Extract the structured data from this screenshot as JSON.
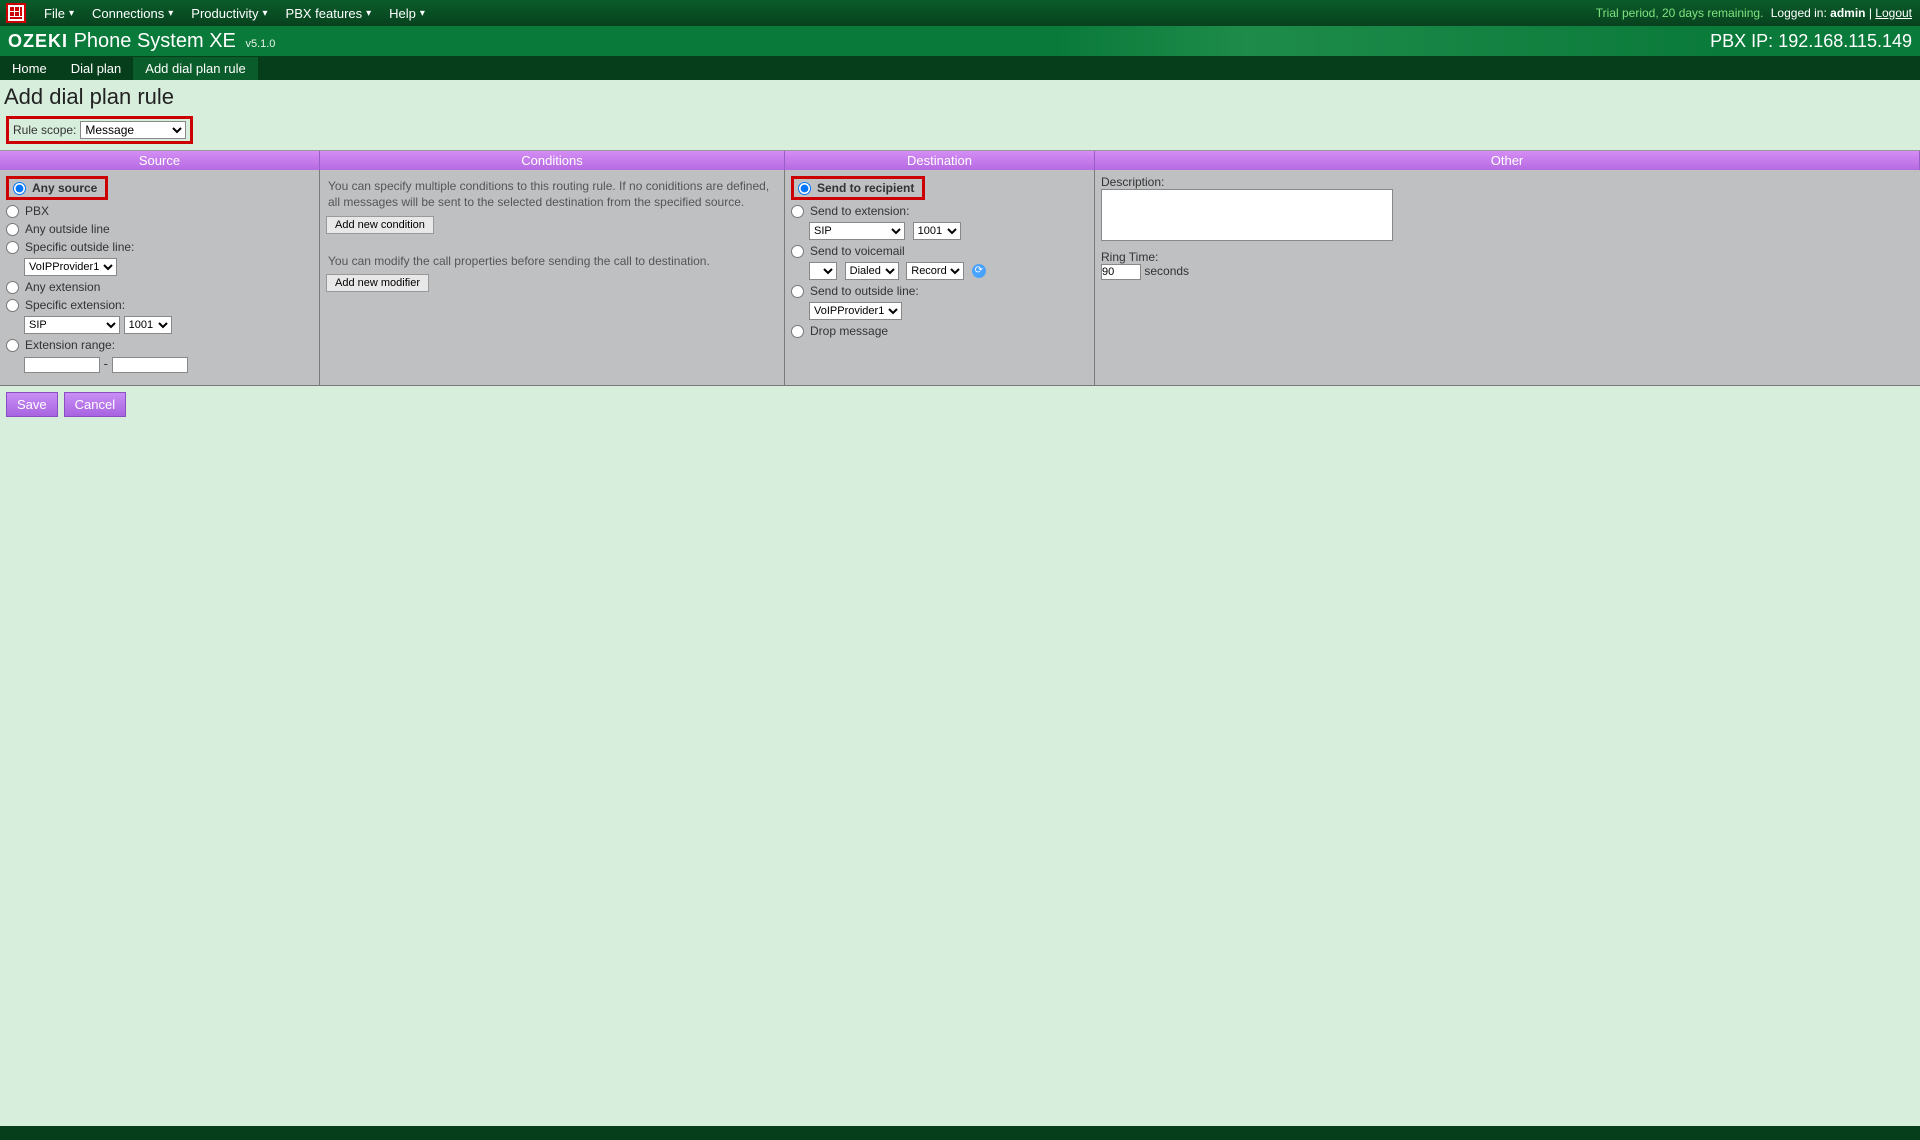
{
  "topnav": {
    "menus": [
      {
        "label": "File"
      },
      {
        "label": "Connections"
      },
      {
        "label": "Productivity"
      },
      {
        "label": "PBX features"
      },
      {
        "label": "Help"
      }
    ],
    "trial_text": "Trial period, 20 days remaining.",
    "logged_in_prefix": "Logged in:",
    "user": "admin",
    "sep": " | ",
    "logout": "Logout"
  },
  "titlebar": {
    "brand_oz": "OZEKI",
    "brand_rest": "Phone System XE",
    "version": "v5.1.0",
    "pbx_ip_label": "PBX IP:",
    "pbx_ip": "192.168.115.149"
  },
  "crumbs": [
    {
      "label": "Home"
    },
    {
      "label": "Dial plan"
    },
    {
      "label": "Add dial plan rule"
    }
  ],
  "page": {
    "title": "Add dial plan rule",
    "scope_label": "Rule scope:",
    "scope_value": "Message"
  },
  "headers": {
    "source": "Source",
    "conditions": "Conditions",
    "destination": "Destination",
    "other": "Other"
  },
  "source": {
    "any_source": "Any source",
    "pbx": "PBX",
    "any_outside": "Any outside line",
    "specific_outside": "Specific outside line:",
    "specific_outside_val": "VoIPProvider1",
    "any_ext": "Any extension",
    "specific_ext": "Specific extension:",
    "specific_ext_proto": "SIP",
    "specific_ext_num": "1001",
    "ext_range": "Extension range:",
    "range_sep": "-"
  },
  "conditions": {
    "text1": "You can specify multiple conditions to this routing rule. If no coniditions are defined, all messages will be sent to the selected destination from the specified source.",
    "add_cond": "Add new condition",
    "text2": "You can modify the call properties before sending the call to destination.",
    "add_mod": "Add new modifier"
  },
  "destination": {
    "send_recipient": "Send to recipient",
    "send_ext": "Send to extension:",
    "ext_proto": "SIP",
    "ext_num": "1001",
    "send_vm": "Send to voicemail",
    "vm_opt1": "",
    "vm_opt2": "Dialed",
    "vm_opt3": "Record",
    "send_outside": "Send to outside line:",
    "outside_val": "VoIPProvider1",
    "drop": "Drop message"
  },
  "other": {
    "desc_label": "Description:",
    "ring_label": "Ring Time:",
    "ring_val": "90",
    "ring_unit": "seconds"
  },
  "actions": {
    "save": "Save",
    "cancel": "Cancel"
  }
}
